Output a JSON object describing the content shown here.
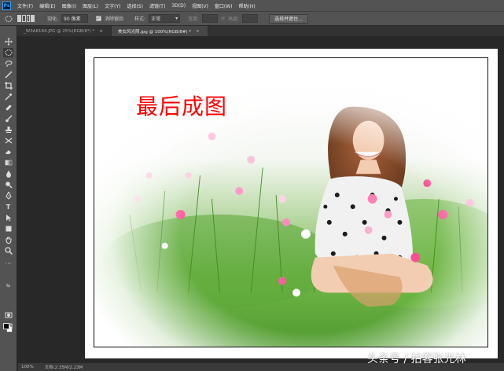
{
  "app": {
    "logo": "Ps"
  },
  "menu": [
    "文件(F)",
    "编辑(E)",
    "图像(I)",
    "图层(L)",
    "文字(Y)",
    "选择(S)",
    "滤镜(T)",
    "3D(D)",
    "视图(V)",
    "窗口(W)",
    "帮助(H)"
  ],
  "options": {
    "feather_label": "羽化:",
    "feather_value": "90 像素",
    "antialias_label": "消除锯齿",
    "style_label": "样式:",
    "style_value": "正常",
    "width_label": "宽度:",
    "height_label": "高度:",
    "select_mask_button": "选择并遮住..."
  },
  "tabs": [
    {
      "label": "_W3A8184.JPG @ 25%(RGB/8*) *",
      "active": false
    },
    {
      "label": "美女风光照.jpg @ 100%(RGB/8#) *",
      "active": true
    }
  ],
  "tools": [
    "move-icon",
    "marquee-icon",
    "lasso-icon",
    "magic-wand-icon",
    "crop-icon",
    "eyedropper-icon",
    "healing-brush-icon",
    "brush-icon",
    "clone-stamp-icon",
    "history-brush-icon",
    "eraser-icon",
    "gradient-icon",
    "blur-icon",
    "dodge-icon",
    "pen-icon",
    "type-icon",
    "path-selection-icon",
    "shape-icon",
    "hand-icon",
    "zoom-icon",
    "more-icon"
  ],
  "canvas": {
    "title": "最后成图"
  },
  "status": {
    "zoom": "100%",
    "doc_info": "文档:2.25M/2.23M"
  },
  "watermark": "头条号 / 拍客张光林",
  "colors": {
    "title_red": "#ff0000",
    "ps_blue": "#31a8ff"
  }
}
